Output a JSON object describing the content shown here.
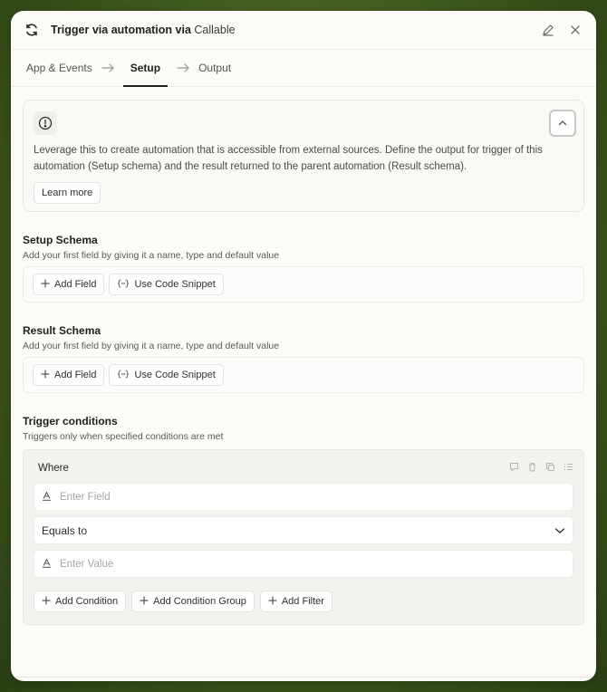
{
  "header": {
    "title": "Trigger via automation via",
    "brand": "Callable"
  },
  "tabs": [
    {
      "label": "App & Events"
    },
    {
      "label": "Setup"
    },
    {
      "label": "Output"
    }
  ],
  "info": {
    "text": "Leverage this to create automation that is accessible from external sources. Define the output for trigger of this automation (Setup schema) and the result returned to the parent automation (Result schema).",
    "learn_more": "Learn more"
  },
  "setup_schema": {
    "title": "Setup Schema",
    "subtitle": "Add your first field by giving it a name, type and default value",
    "add_field": "Add Field",
    "use_snippet": "Use Code Snippet"
  },
  "result_schema": {
    "title": "Result Schema",
    "subtitle": "Add your first field by giving it a name, type and default value",
    "add_field": "Add Field",
    "use_snippet": "Use Code Snippet"
  },
  "trigger_conditions": {
    "title": "Trigger conditions",
    "subtitle": "Triggers only when specified conditions are met",
    "where": "Where",
    "field_placeholder": "Enter Field",
    "operator": "Equals to",
    "value_placeholder": "Enter Value",
    "add_condition": "Add Condition",
    "add_condition_group": "Add Condition Group",
    "add_filter": "Add Filter"
  }
}
